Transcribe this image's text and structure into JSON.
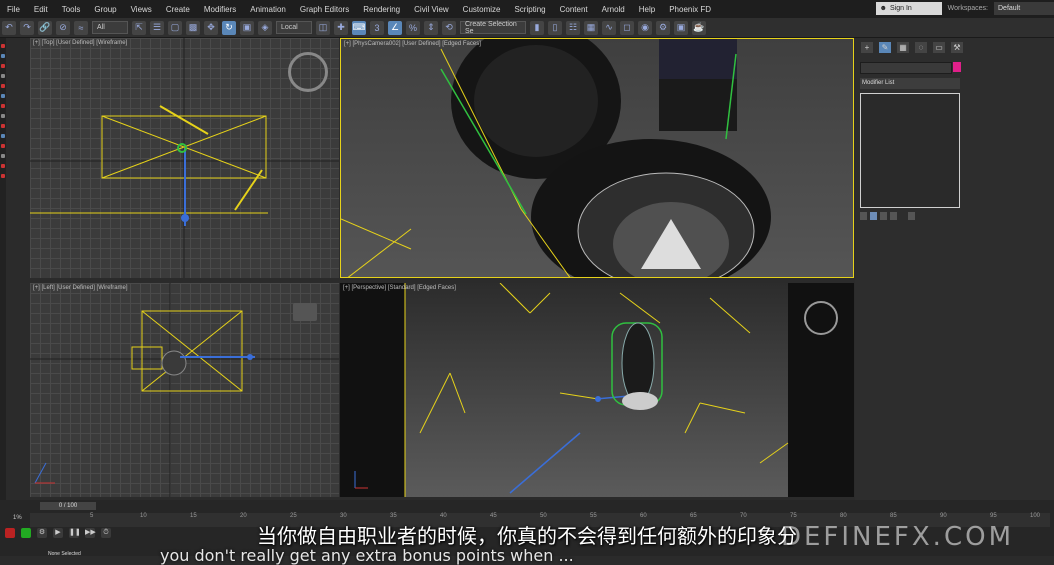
{
  "menu": {
    "items": [
      "File",
      "Edit",
      "Tools",
      "Group",
      "Views",
      "Create",
      "Modifiers",
      "Animation",
      "Graph Editors",
      "Rendering",
      "Civil View",
      "Customize",
      "Scripting",
      "Content",
      "Arnold",
      "Help",
      "Phoenix FD"
    ],
    "sign_in": "Sign In",
    "workspaces_label": "Workspaces:",
    "workspace_value": "Default"
  },
  "toolbar": {
    "filter_value": "All",
    "coord_value": "Local",
    "selection_set": "Create Selection Se"
  },
  "viewports": {
    "top": "[+] [Top] [User Defined] [Wireframe]",
    "camera": "[+] [PhysCamera002] [User Defined] [Edged Faces]",
    "left": "[+] [Left] [User Defined] [Wireframe]",
    "perspective": "[+] [Perspective] [Standard] [Edged Faces]"
  },
  "command_panel": {
    "modifier_list": "Modifier List"
  },
  "timeline": {
    "frame_slider": "0 / 100",
    "ticks": [
      "5",
      "10",
      "15",
      "20",
      "25",
      "30",
      "35",
      "40",
      "45",
      "50",
      "55",
      "60",
      "65",
      "70",
      "75",
      "80",
      "85",
      "90",
      "95",
      "100"
    ],
    "zoom_percent": "1%",
    "status": "None Selected"
  },
  "overlay": {
    "subtitle_cn": "当你做自由职业者的时候，你真的不会得到任何额外的印象分",
    "subtitle_en": "you don't really get any extra bonus points when ...",
    "watermark": "DEFINEFX.COM"
  },
  "colors": {
    "selection_yellow": "#e6d21a",
    "active_blue": "#5a87b8",
    "modifier_pink": "#e0208a",
    "green_wire": "#30c040"
  }
}
